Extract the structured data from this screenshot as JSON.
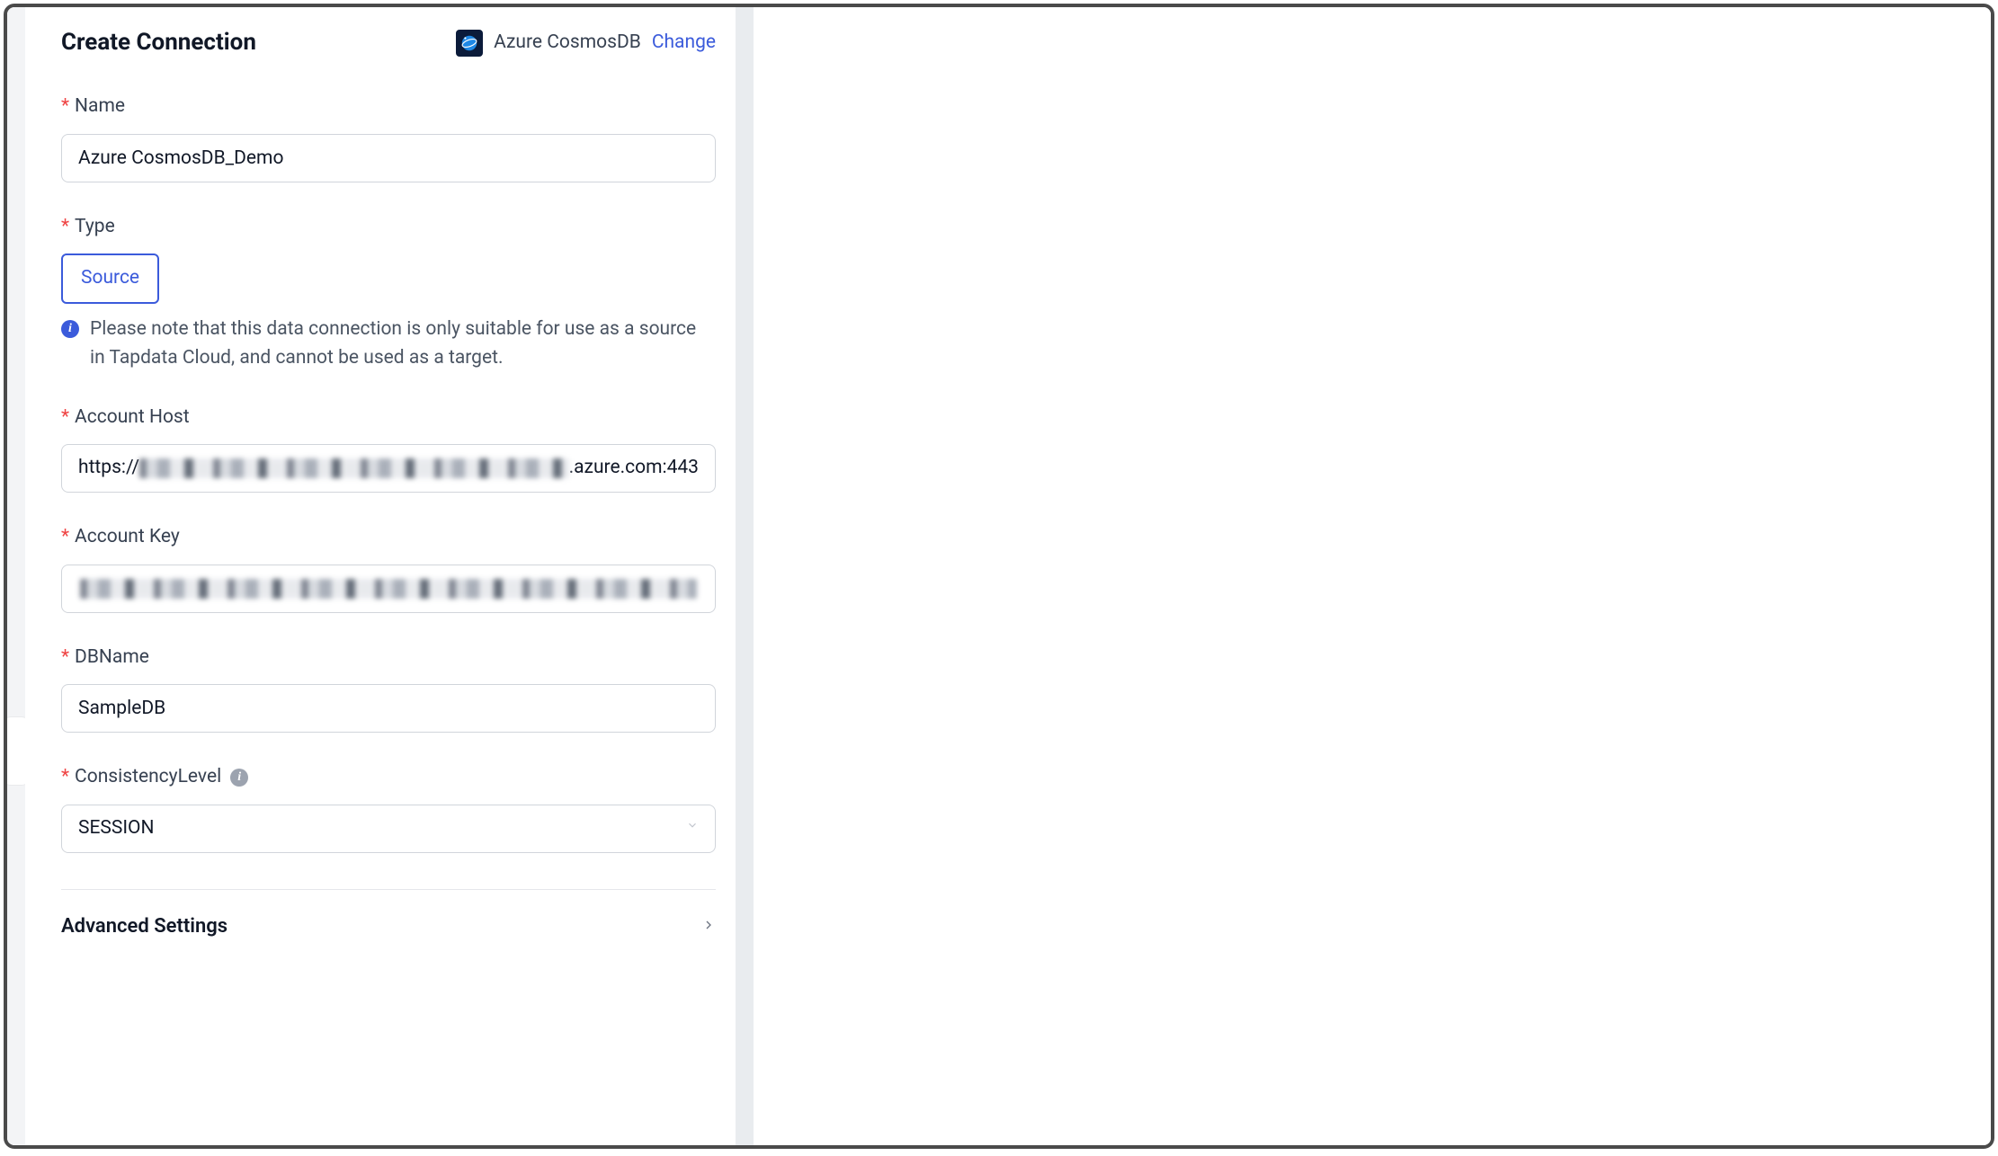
{
  "header": {
    "title": "Create Connection",
    "connector_name": "Azure CosmosDB",
    "change_label": "Change"
  },
  "form": {
    "name": {
      "label": "Name",
      "value": "Azure CosmosDB_Demo"
    },
    "type": {
      "label": "Type",
      "selected_chip": "Source",
      "note": "Please note that this data connection is only suitable for use as a source in Tapdata Cloud, and cannot be used as a target."
    },
    "account_host": {
      "label": "Account Host",
      "prefix": "https://",
      "suffix": ".azure.com:443"
    },
    "account_key": {
      "label": "Account Key"
    },
    "dbname": {
      "label": "DBName",
      "value": "SampleDB"
    },
    "consistency": {
      "label": "ConsistencyLevel",
      "value": "SESSION"
    }
  },
  "advanced": {
    "label": "Advanced Settings"
  }
}
